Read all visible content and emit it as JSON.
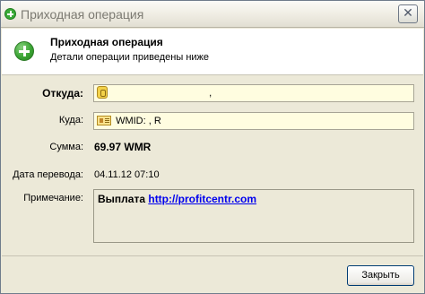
{
  "window": {
    "title": "Приходная операция",
    "close_glyph": "✕"
  },
  "header": {
    "title": "Приходная операция",
    "subtitle": "Детали операции приведены ниже",
    "icon": "green-plus-icon"
  },
  "form": {
    "from_label": "Откуда:",
    "from_value": ", ",
    "to_label": "Куда:",
    "to_value": "WMID: , R",
    "amount_label": "Сумма:",
    "amount_value": "69.97 WMR",
    "date_label": "Дата перевода:",
    "date_value": "04.11.12 07:10",
    "note_label": "Примечание:",
    "note_prefix": "Выплата",
    "note_link": "http://profitcentr.com"
  },
  "buttons": {
    "close_label": "Закрыть"
  }
}
